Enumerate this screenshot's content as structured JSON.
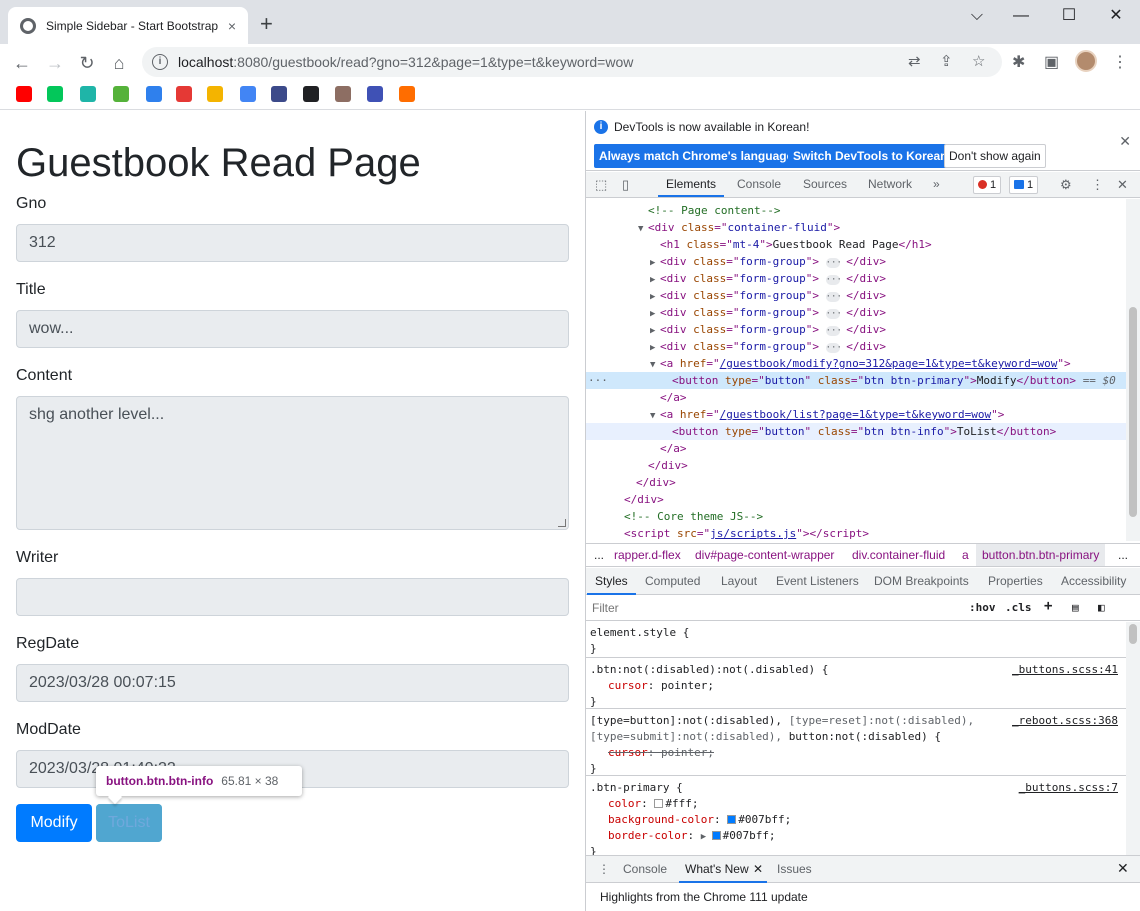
{
  "browser": {
    "tab_title": "Simple Sidebar - Start Bootstrap",
    "tab_close": "×",
    "new_tab": "+",
    "window_controls": {
      "minimize": "⌵",
      "restore": "—",
      "maximize": "☐",
      "close": "✕"
    },
    "url_host": "localhost",
    "url_rest": ":8080/guestbook/read?gno=312&page=1&type=t&keyword=wow",
    "nav": {
      "back": "←",
      "forward": "→",
      "reload": "↻",
      "home": "⌂"
    },
    "bookmark_colors": [
      "#ff0000",
      "#03c75a",
      "#1fb5a8",
      "#55b23a",
      "#2f80ed",
      "#e53935",
      "#f4b400",
      "#4285f4",
      "#3c4a8a",
      "#202124",
      "#8d6e63",
      "#3f51b5",
      "#ff6d00"
    ]
  },
  "page": {
    "heading": "Guestbook Read Page",
    "fields": [
      {
        "label": "Gno",
        "value": "312"
      },
      {
        "label": "Title",
        "value": "wow..."
      },
      {
        "label": "Content",
        "value": "shg another level..."
      },
      {
        "label": "Writer",
        "value": ""
      },
      {
        "label": "RegDate",
        "value": "2023/03/28 00:07:15"
      },
      {
        "label": "ModDate",
        "value": "2023/03/28 01:40:22"
      }
    ],
    "modify_button": "Modify",
    "tolist_button": "ToList",
    "tooltip_selector": "button.btn.btn-info",
    "tooltip_size": "65.81 × 38",
    "colors": {
      "primary": "#007bff",
      "info": "#17a2b8"
    }
  },
  "devtools": {
    "banner_message": "DevTools is now available in Korean!",
    "banner_buttons": [
      "Always match Chrome's language",
      "Switch DevTools to Korean",
      "Don't show again"
    ],
    "main_tabs": [
      "Elements",
      "Console",
      "Sources",
      "Network"
    ],
    "more_tabs": "»",
    "error_count": "1",
    "message_count": "1",
    "elements": {
      "comment_page_content": "<!-- Page content-->",
      "container_open": "div",
      "container_class": "container-fluid",
      "h1_class": "mt-4",
      "h1_text": "Guestbook Read Page",
      "form_group_class": "form-group",
      "modify_href": "/guestbook/modify?gno=312&page=1&type=t&keyword=wow",
      "list_href": "/guestbook/list?page=1&type=t&keyword=wow",
      "btn_type": "button",
      "modify_btn_class": "btn btn-primary",
      "modify_btn_text": "Modify",
      "tolist_btn_class": "btn btn-info",
      "tolist_btn_text": "ToList",
      "selected_marker": "== $0",
      "comment_core_js": "<!-- Core theme JS-->",
      "script_src": "js/scripts.js"
    },
    "breadcrumbs": [
      "...",
      "rapper.d-flex",
      "div#page-content-wrapper",
      "div.container-fluid",
      "a",
      "button.btn.btn-primary",
      "..."
    ],
    "sub_tabs": [
      "Styles",
      "Computed",
      "Layout",
      "Event Listeners",
      "DOM Breakpoints",
      "Properties",
      "Accessibility"
    ],
    "filter_placeholder": "Filter",
    "hov": ":hov",
    "cls": ".cls",
    "styles": {
      "element_style": "element.style {",
      "rule1_selector": ".btn:not(:disabled):not(.disabled) {",
      "rule1_source": "_buttons.scss:41",
      "rule1_prop": "cursor",
      "rule1_val": "pointer;",
      "rule2_selector_a": "[type=button]:not(:disabled),",
      "rule2_selector_b": "[type=reset]:not(:disabled),",
      "rule2_selector_c": "[type=submit]:not(:disabled),",
      "rule2_selector_d": "button:not(:disabled) {",
      "rule2_source": "_reboot.scss:368",
      "rule2_prop": "cursor",
      "rule2_val": "pointer;",
      "rule3_selector": ".btn-primary {",
      "rule3_source": "_buttons.scss:7",
      "rule3_props": [
        {
          "name": "color",
          "value": "#fff;",
          "swatch": "#ffffff"
        },
        {
          "name": "background-color",
          "value": "#007bff;",
          "swatch": "#007bff"
        },
        {
          "name": "border-color",
          "value": "#007bff;",
          "swatch": "#007bff"
        }
      ],
      "close_brace": "}"
    },
    "drawer_tabs": [
      "Console",
      "What's New"
    ],
    "drawer_extra_tab": "Issues",
    "drawer_message": "Highlights from the Chrome 111 update"
  }
}
